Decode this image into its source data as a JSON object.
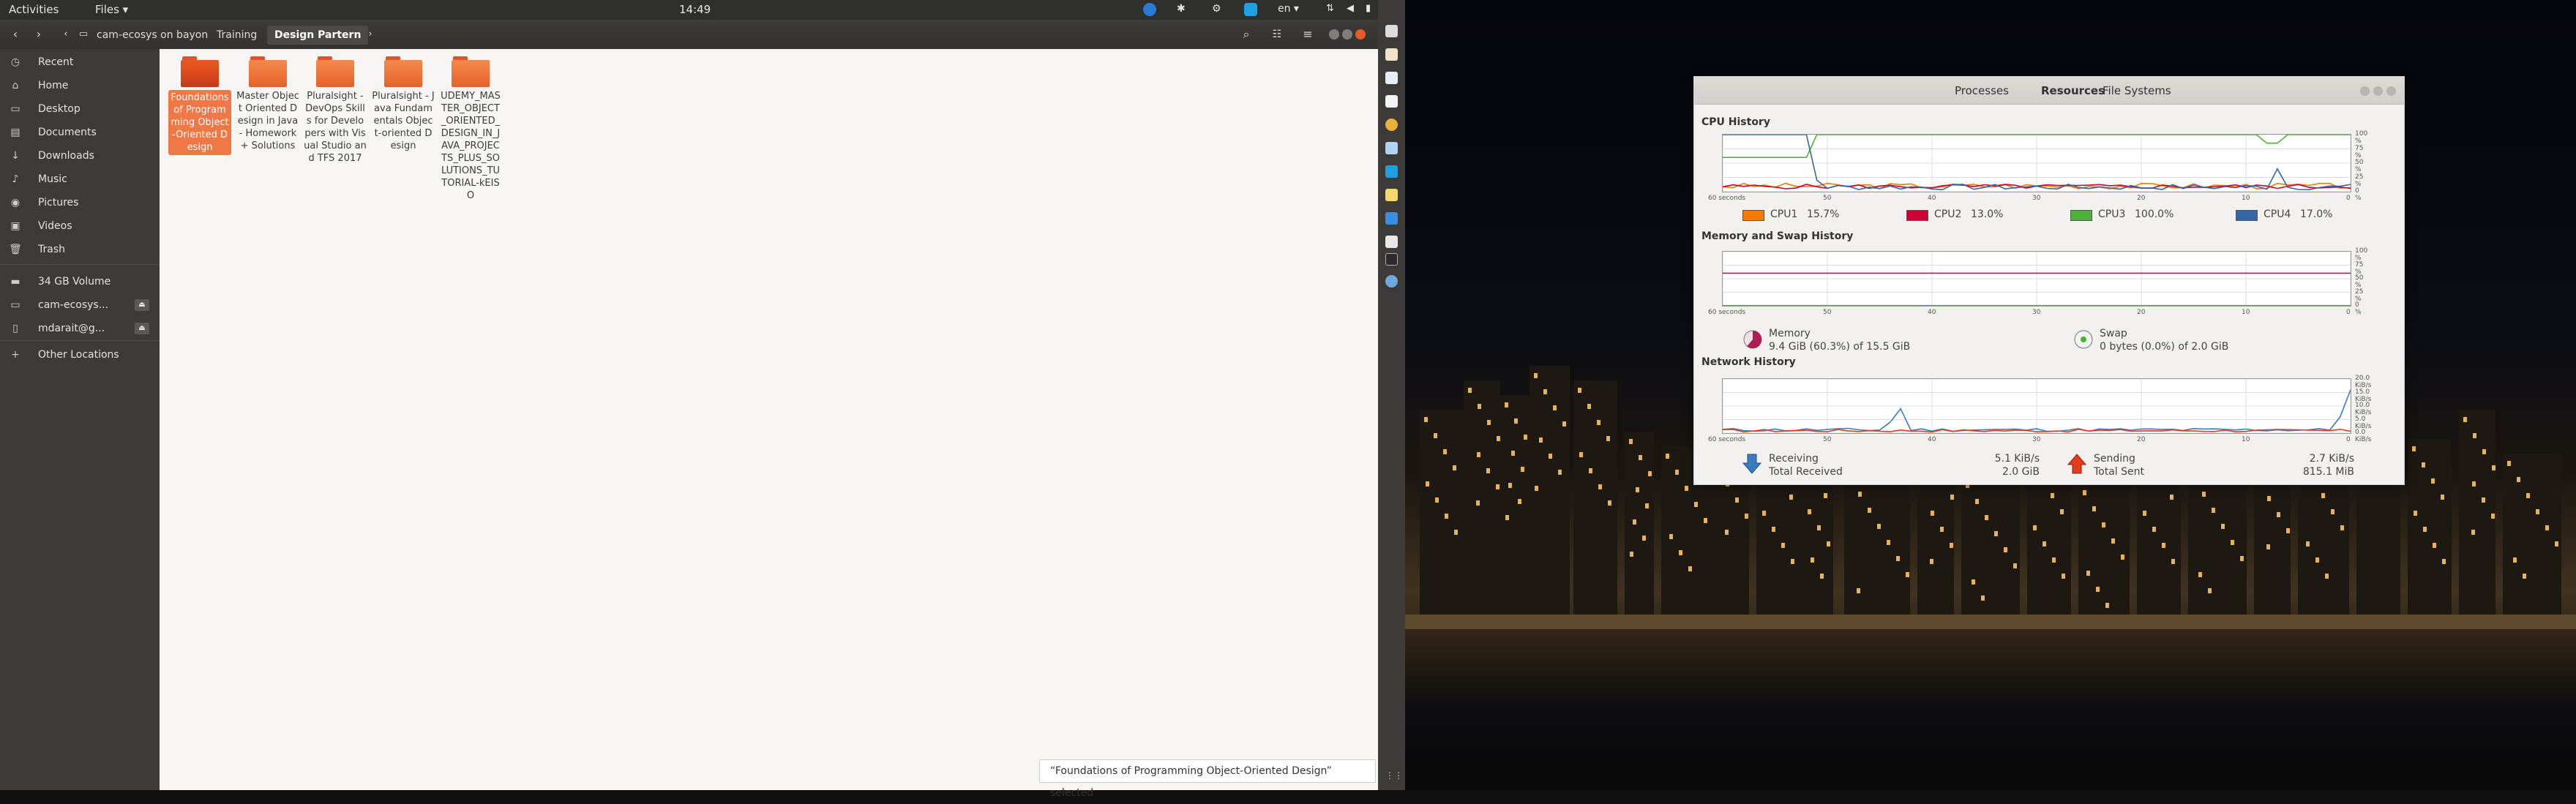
{
  "topbar": {
    "activities": "Activities",
    "app_menu": "Files ▾",
    "clock": "14:49",
    "lang": "en ▾"
  },
  "files": {
    "breadcrumbs": [
      "cam-ecosys on bayon",
      "Training",
      "Design Partern"
    ],
    "sidebar": [
      {
        "icon": "clock-icon",
        "glyph": "◷",
        "label": "Recent"
      },
      {
        "icon": "home-icon",
        "glyph": "⌂",
        "label": "Home"
      },
      {
        "icon": "desktop-icon",
        "glyph": "▭",
        "label": "Desktop"
      },
      {
        "icon": "documents-icon",
        "glyph": "▤",
        "label": "Documents"
      },
      {
        "icon": "downloads-icon",
        "glyph": "↓",
        "label": "Downloads"
      },
      {
        "icon": "music-icon",
        "glyph": "♪",
        "label": "Music"
      },
      {
        "icon": "pictures-icon",
        "glyph": "◉",
        "label": "Pictures"
      },
      {
        "icon": "videos-icon",
        "glyph": "▣",
        "label": "Videos"
      },
      {
        "icon": "trash-icon",
        "glyph": "🗑",
        "label": "Trash"
      },
      {
        "icon": "drive-icon",
        "glyph": "▬",
        "label": "34 GB Volume"
      },
      {
        "icon": "network-drive-icon",
        "glyph": "▭",
        "label": "cam-ecosys..."
      },
      {
        "icon": "network-drive-icon",
        "glyph": "▯",
        "label": "mdarait@g..."
      },
      {
        "icon": "plus-icon",
        "glyph": "+",
        "label": "Other Locations"
      }
    ],
    "folders": [
      "Foundations of Programming Object-Oriented Design",
      "Master Object Oriented Design in Java - Homework + Solutions",
      "Pluralsight - DevOps Skills for Developers with Visual Studio and TFS 2017",
      "Pluralsight - Java Fundamentals Object-oriented Design",
      "UDEMY_MASTER_OBJECT_ORIENTED_DESIGN_IN_JAVA_PROJECTS_PLUS_SOLUTIONS_TUTORIAL-kEISO"
    ],
    "status": "“Foundations of Programming Object-Oriented Design” selected"
  },
  "sysmon": {
    "tabs": [
      "Processes",
      "Resources",
      "File Systems"
    ],
    "cpu_title": "CPU History",
    "mem_title": "Memory and Swap History",
    "net_title": "Network History",
    "y_pct": [
      "100 %",
      "75 %",
      "50 %",
      "25 %",
      "0 %"
    ],
    "y_net": [
      "20.0 KiB/s",
      "15.0 KiB/s",
      "10.0 KiB/s",
      "5.0 KiB/s",
      "0.0 KiB/s"
    ],
    "x_ticks": [
      "60 seconds",
      "50",
      "40",
      "30",
      "20",
      "10",
      "0"
    ],
    "cpus": [
      {
        "label": "CPU1",
        "value": "15.7%",
        "color": "#f57900"
      },
      {
        "label": "CPU2",
        "value": "13.0%",
        "color": "#cc0033"
      },
      {
        "label": "CPU3",
        "value": "100.0%",
        "color": "#4eb13b"
      },
      {
        "label": "CPU4",
        "value": "17.0%",
        "color": "#3465a4"
      }
    ],
    "memory": {
      "label": "Memory",
      "value": "9.4 GiB (60.3%) of 15.5 GiB",
      "color": "#ad1f57"
    },
    "swap": {
      "label": "Swap",
      "value": "0 bytes (0.0%) of 2.0 GiB",
      "color": "#4eb13b"
    },
    "net": {
      "receiving_label": "Receiving",
      "receiving_value": "5.1 KiB/s",
      "total_received_label": "Total Received",
      "total_received_value": "2.0 GiB",
      "sending_label": "Sending",
      "sending_value": "2.7 KiB/s",
      "total_sent_label": "Total Sent",
      "total_sent_value": "815.1 MiB"
    }
  }
}
